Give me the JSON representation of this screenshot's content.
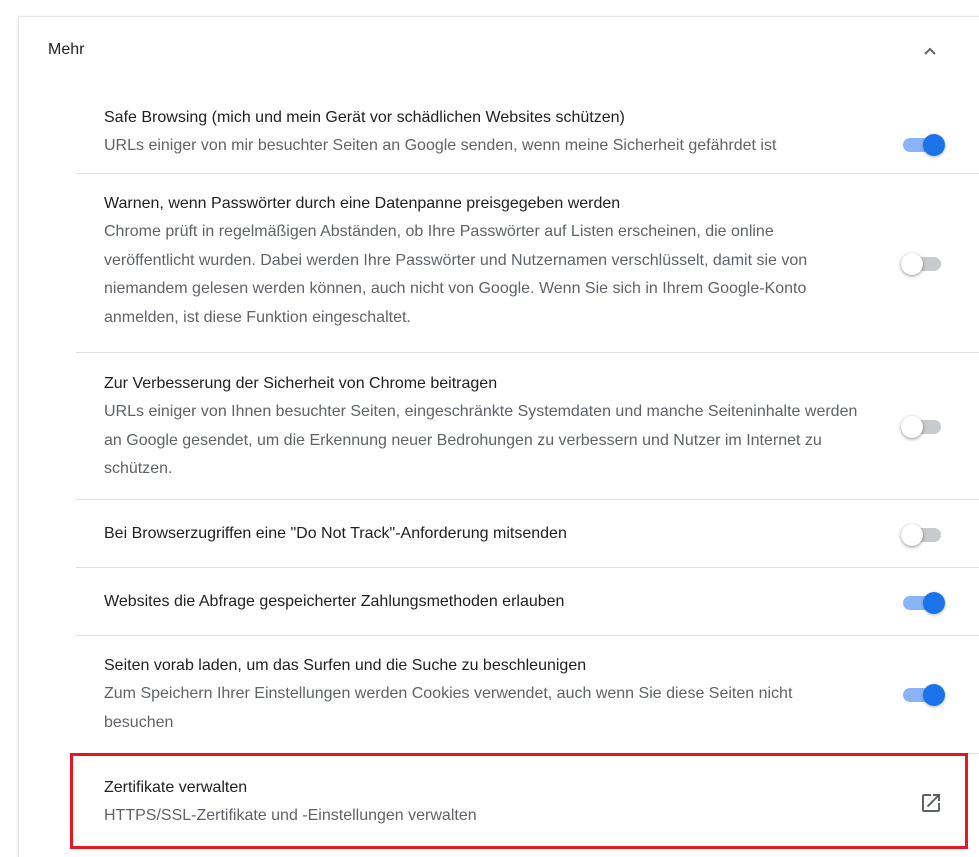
{
  "section": {
    "title": "Mehr",
    "chevron_icon": "chevron-up-icon"
  },
  "settings": [
    {
      "title": "Safe Browsing (mich und mein Gerät vor schädlichen Websites schützen)",
      "description": "URLs einiger von mir besuchter Seiten an Google senden, wenn meine Sicherheit gefährdet ist",
      "enabled": true
    },
    {
      "title": "Warnen, wenn Passwörter durch eine Datenpanne preisgegeben werden",
      "description": "Chrome prüft in regelmäßigen Abständen, ob Ihre Passwörter auf Listen erscheinen, die online veröffentlicht wurden. Dabei werden Ihre Passwörter und Nutzernamen verschlüsselt, damit sie von niemandem gelesen werden können, auch nicht von Google. Wenn Sie sich in Ihrem Google-Konto anmelden, ist diese Funktion eingeschaltet.",
      "enabled": false
    },
    {
      "title": "Zur Verbesserung der Sicherheit von Chrome beitragen",
      "description": "URLs einiger von Ihnen besuchter Seiten, eingeschränkte Systemdaten und manche Seiteninhalte werden an Google gesendet, um die Erkennung neuer Bedrohungen zu verbessern und Nutzer im Internet zu schützen.",
      "enabled": false
    },
    {
      "title": "Bei Browserzugriffen eine \"Do Not Track\"-Anforderung mitsenden",
      "description": "",
      "enabled": false
    },
    {
      "title": "Websites die Abfrage gespeicherter Zahlungsmethoden erlauben",
      "description": "",
      "enabled": true
    },
    {
      "title": "Seiten vorab laden, um das Surfen und die Suche zu beschleunigen",
      "description": "Zum Speichern Ihrer Einstellungen werden Cookies verwendet, auch wenn Sie diese Seiten nicht besuchen",
      "enabled": true
    }
  ],
  "certificates": {
    "title": "Zertifikate verwalten",
    "description": "HTTPS/SSL-Zertifikate und -Einstellungen verwalten",
    "icon": "open-in-new-icon",
    "highlighted": true
  },
  "colors": {
    "accent": "#1a73e8",
    "toggle_track_on": "#8ab4f8",
    "highlight": "#e8161e"
  }
}
